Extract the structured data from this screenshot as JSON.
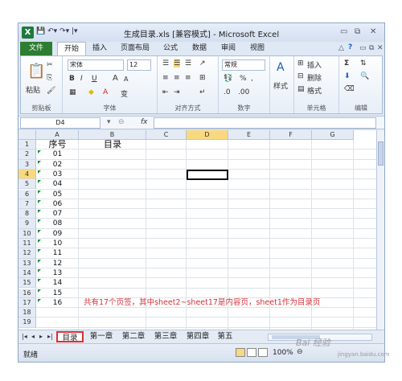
{
  "window": {
    "title": "生成目录.xls [兼容模式] - Microsoft Excel",
    "app_icon": "X"
  },
  "ribbon_tabs": [
    "文件",
    "开始",
    "插入",
    "页面布局",
    "公式",
    "数据",
    "审阅",
    "视图"
  ],
  "ribbon": {
    "clipboard": {
      "paste_label": "粘贴",
      "group": "剪贴板"
    },
    "font": {
      "name": "宋体",
      "size": "12",
      "group": "字体",
      "bold": "B",
      "italic": "I",
      "underline": "U",
      "grow": "A",
      "shrink": "A"
    },
    "alignment": {
      "group": "对齐方式"
    },
    "number": {
      "format": "常规",
      "percent": "%",
      "comma": ",",
      "group": "数字"
    },
    "styles": {
      "label": "样式"
    },
    "cells": {
      "insert": "插入",
      "delete": "删除",
      "format": "格式",
      "group": "单元格"
    },
    "editing": {
      "sigma": "Σ",
      "group": "编辑"
    }
  },
  "formula_bar": {
    "name_box": "D4",
    "fx": "fx",
    "content": ""
  },
  "columns": [
    "A",
    "B",
    "C",
    "D",
    "E",
    "F",
    "G"
  ],
  "selected_column": "D",
  "rows": [
    "1",
    "2",
    "3",
    "4",
    "5",
    "6",
    "7",
    "8",
    "9",
    "10",
    "11",
    "12",
    "13",
    "14",
    "15",
    "16",
    "17",
    "18",
    "19"
  ],
  "selected_row": "4",
  "cells": {
    "A1": "序号",
    "B1": "目录",
    "A_values": [
      "01",
      "02",
      "03",
      "04",
      "05",
      "06",
      "07",
      "08",
      "09",
      "10",
      "11",
      "12",
      "13",
      "14",
      "15",
      "16"
    ]
  },
  "annotation_text": "共有17个页签，其中sheet2~sheet17是内容页，sheet1作为目录页",
  "sheet_tabs": [
    "目录",
    "第一章",
    "第二章",
    "第三章",
    "第四章",
    "第五"
  ],
  "active_sheet": "目录",
  "status": {
    "ready": "就绪",
    "zoom": "100%"
  },
  "colors": {
    "file_tab": "#2e7d32",
    "annotation": "#d6313b",
    "highlight_border": "#e03030",
    "selected_header": "#f8d97f"
  },
  "watermark": {
    "text": "Bai 经验",
    "url": "jingyan.baidu.com"
  }
}
